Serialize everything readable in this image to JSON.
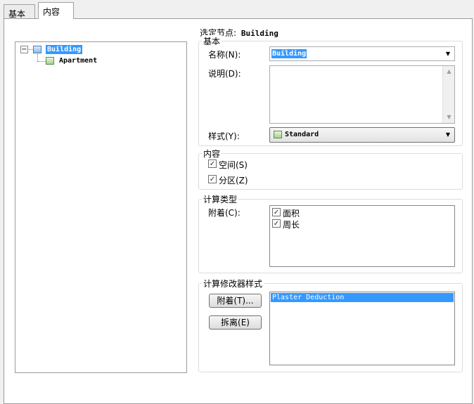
{
  "tabs": [
    {
      "label": "基本"
    },
    {
      "label": "内容"
    }
  ],
  "tree": {
    "root": {
      "label": "Building",
      "toggle": "⊟"
    },
    "child": {
      "label": "Apartment"
    }
  },
  "selected_node": {
    "label": "选定节点:",
    "value": "Building"
  },
  "basic": {
    "title": "基本",
    "name_label": "名称(N):",
    "name_value": "Building",
    "desc_label": "说明(D):",
    "style_label": "样式(Y):",
    "style_value": "Standard"
  },
  "content": {
    "title": "内容",
    "items": [
      {
        "label": "空间(S)",
        "checked": "✓"
      },
      {
        "label": "分区(Z)",
        "checked": "✓"
      }
    ]
  },
  "calc_type": {
    "title": "计算类型",
    "attach_label": "附着(C):",
    "items": [
      {
        "label": "面积",
        "checked": "✓"
      },
      {
        "label": "周长",
        "checked": "✓"
      }
    ]
  },
  "modifier": {
    "title": "计算修改器样式",
    "attach_button": "附着(T)...",
    "detach_button": "拆离(E)",
    "list": [
      "Plaster Deduction"
    ]
  },
  "icons": {
    "dropdown": "▼",
    "scroll_up": "▲",
    "scroll_down": "▼"
  }
}
